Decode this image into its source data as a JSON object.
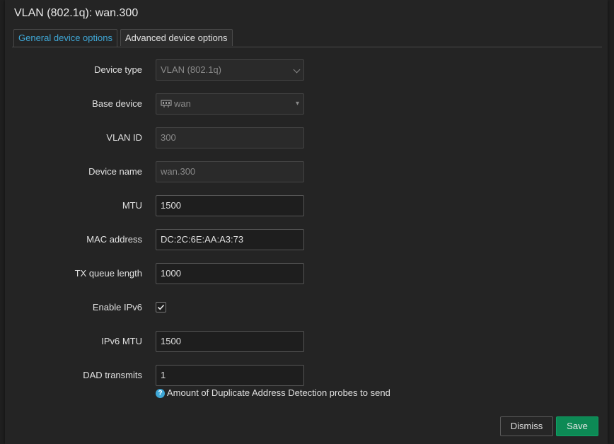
{
  "dialog": {
    "title": "VLAN (802.1q): wan.300"
  },
  "tabs": [
    {
      "label": "General device options"
    },
    {
      "label": "Advanced device options"
    }
  ],
  "fields": {
    "device_type": {
      "label": "Device type",
      "value": "VLAN (802.1q)"
    },
    "base_device": {
      "label": "Base device",
      "value": "wan"
    },
    "vlan_id": {
      "label": "VLAN ID",
      "value": "300"
    },
    "device_name": {
      "label": "Device name",
      "value": "wan.300"
    },
    "mtu": {
      "label": "MTU",
      "value": "1500"
    },
    "mac_address": {
      "label": "MAC address",
      "value": "DC:2C:6E:AA:A3:73"
    },
    "tx_queue_length": {
      "label": "TX queue length",
      "value": "1000"
    },
    "enable_ipv6": {
      "label": "Enable IPv6",
      "checked": true
    },
    "ipv6_mtu": {
      "label": "IPv6 MTU",
      "value": "1500"
    },
    "dad_transmits": {
      "label": "DAD transmits",
      "value": "1",
      "help": "Amount of Duplicate Address Detection probes to send"
    }
  },
  "buttons": {
    "dismiss": "Dismiss",
    "save": "Save"
  },
  "colors": {
    "accent": "#3fa7d6",
    "save": "#0d8a55",
    "background": "#242424"
  }
}
